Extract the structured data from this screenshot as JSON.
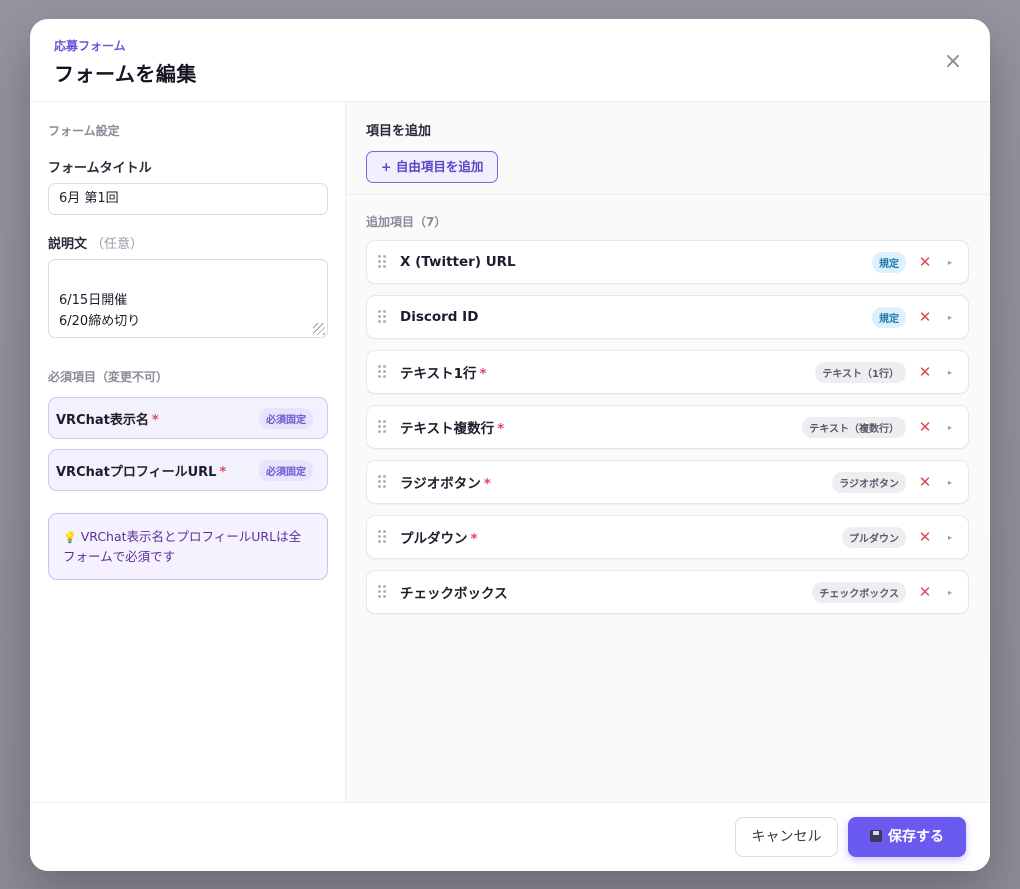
{
  "modal": {
    "eyebrow": "応募フォーム",
    "title": "フォームを編集",
    "close_icon": "×"
  },
  "left": {
    "section_label": "フォーム設定",
    "title_label": "フォームタイトル",
    "title_value": "6月 第1回",
    "desc_label": "説明文",
    "desc_optional": "（任意）",
    "desc_value": "6/15日開催\n6/20締め切り",
    "required_label": "必須項目（変更不可）",
    "required_items": [
      {
        "name": "VRChat表示名",
        "star": "*",
        "badge": "必須固定"
      },
      {
        "name": "VRChatプロフィールURL",
        "star": "*",
        "badge": "必須固定"
      }
    ],
    "info_icon": "💡",
    "info_text": "VRChat表示名とプロフィールURLは全フォームで必須です"
  },
  "right": {
    "add_label": "項目を追加",
    "add_button": "+ 自由項目を追加",
    "list_head": "追加項目（7）",
    "items": [
      {
        "name": "X (Twitter) URL",
        "star": "",
        "badge": "規定",
        "badge_kind": "default"
      },
      {
        "name": "Discord ID",
        "star": "",
        "badge": "規定",
        "badge_kind": "default"
      },
      {
        "name": "テキスト1行",
        "star": "*",
        "badge": "テキスト（1行）",
        "badge_kind": "type"
      },
      {
        "name": "テキスト複数行",
        "star": "*",
        "badge": "テキスト（複数行）",
        "badge_kind": "type"
      },
      {
        "name": "ラジオボタン",
        "star": "*",
        "badge": "ラジオボタン",
        "badge_kind": "type"
      },
      {
        "name": "プルダウン",
        "star": "*",
        "badge": "プルダウン",
        "badge_kind": "type"
      },
      {
        "name": "チェックボックス",
        "star": "",
        "badge": "チェックボックス",
        "badge_kind": "type"
      }
    ],
    "delete_icon": "✕",
    "expand_icon": "▸"
  },
  "footer": {
    "cancel": "キャンセル",
    "save": "保存する"
  },
  "colors": {
    "accent": "#6a5af0",
    "danger": "#e0495a",
    "required_bg": "#f4f1fe"
  }
}
